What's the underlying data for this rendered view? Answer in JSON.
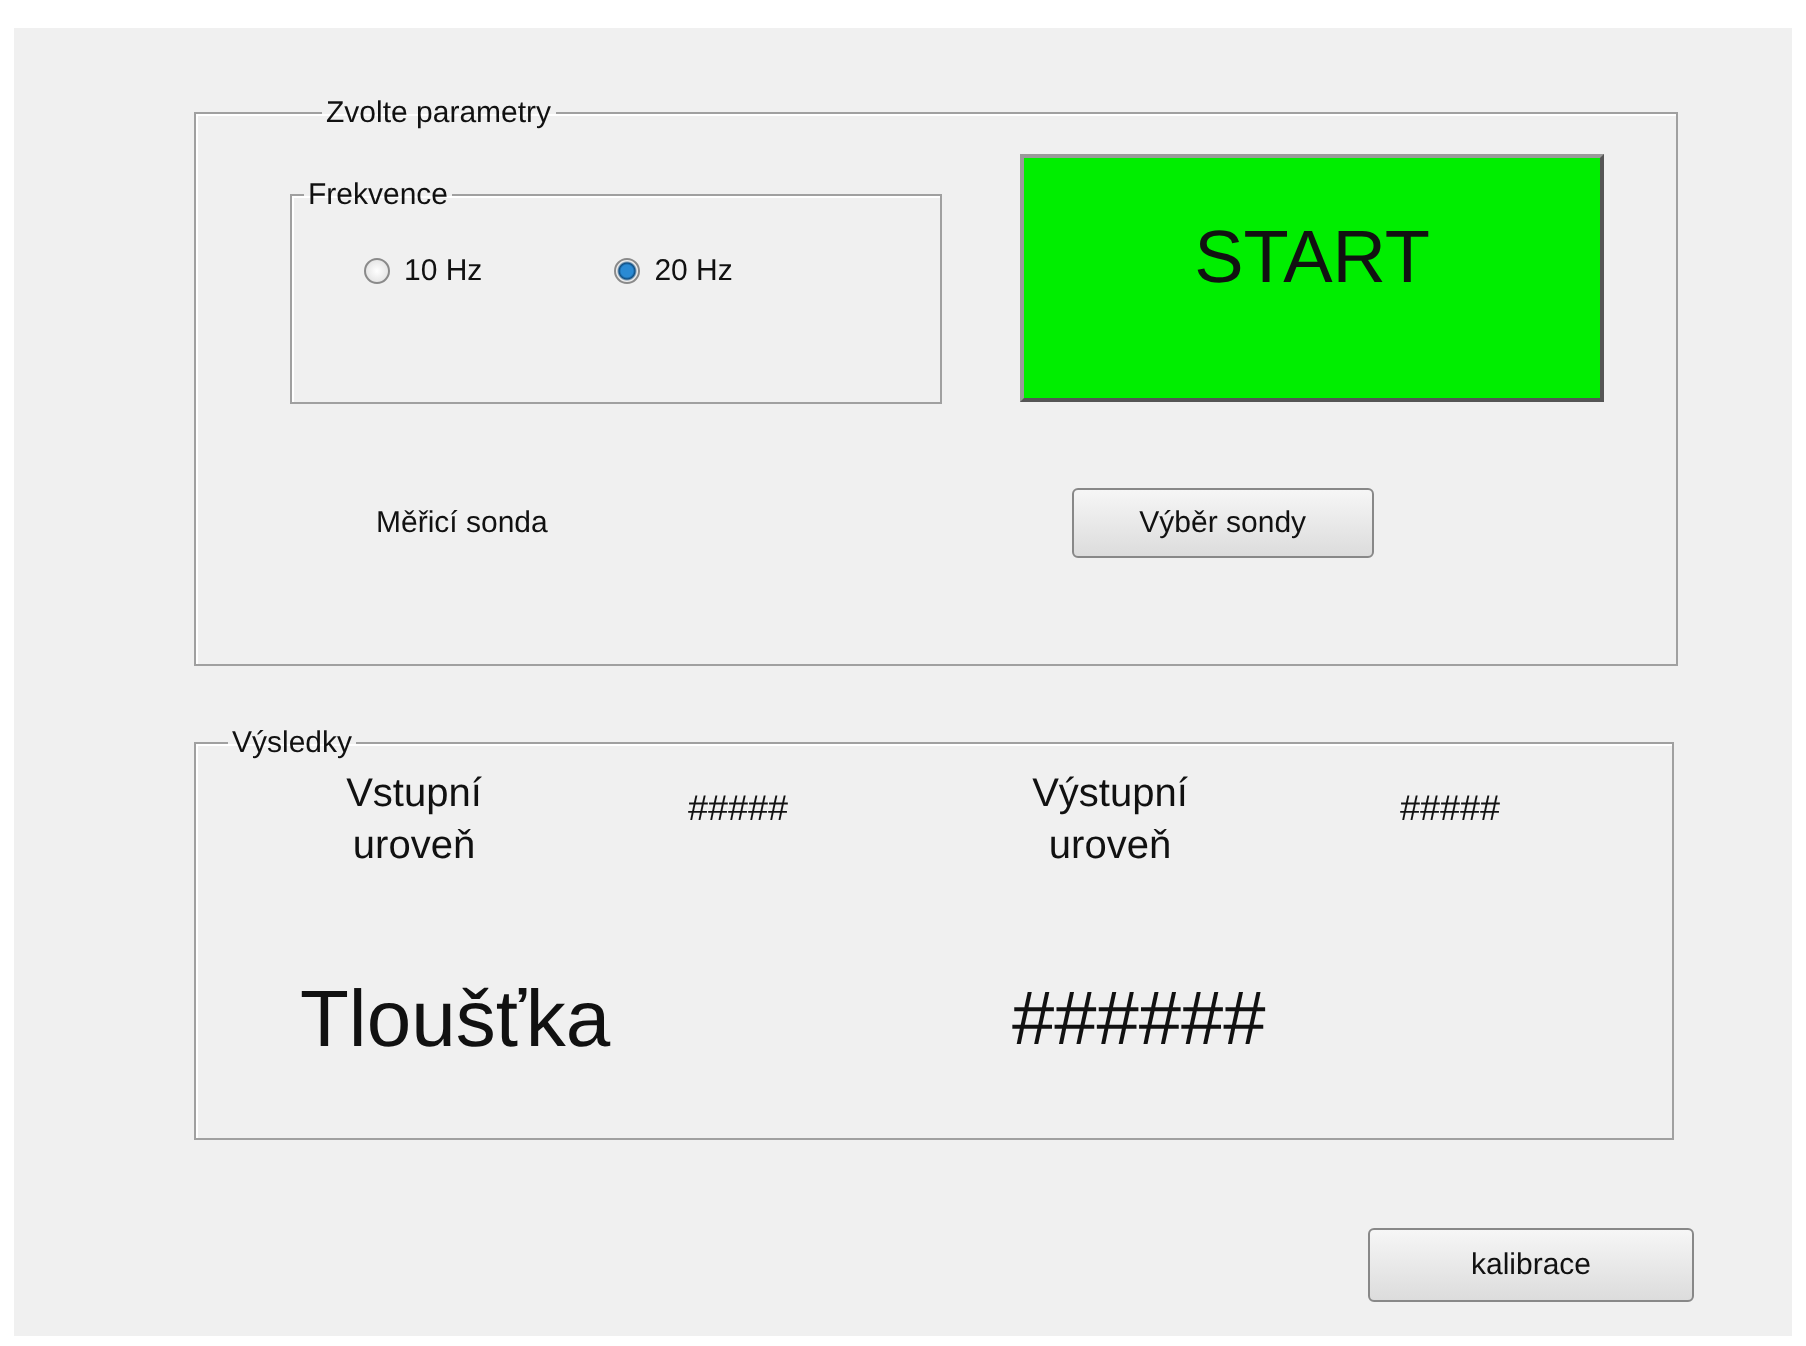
{
  "parameters": {
    "title": "Zvolte parametry",
    "frequency": {
      "title": "Frekvence",
      "options": [
        {
          "label": "10 Hz",
          "selected": false
        },
        {
          "label": "20 Hz",
          "selected": true
        }
      ]
    },
    "probe_label": "Měřicí sonda",
    "start_button": "START",
    "probe_button": "Výběr sondy"
  },
  "results": {
    "title": "Výsledky",
    "input_level": {
      "label": "Vstupní uroveň",
      "value": "#####"
    },
    "output_level": {
      "label": "Výstupní uroveň",
      "value": "#####"
    },
    "thickness": {
      "label": "Tloušťka",
      "value": "######"
    }
  },
  "calibration_button": "kalibrace"
}
